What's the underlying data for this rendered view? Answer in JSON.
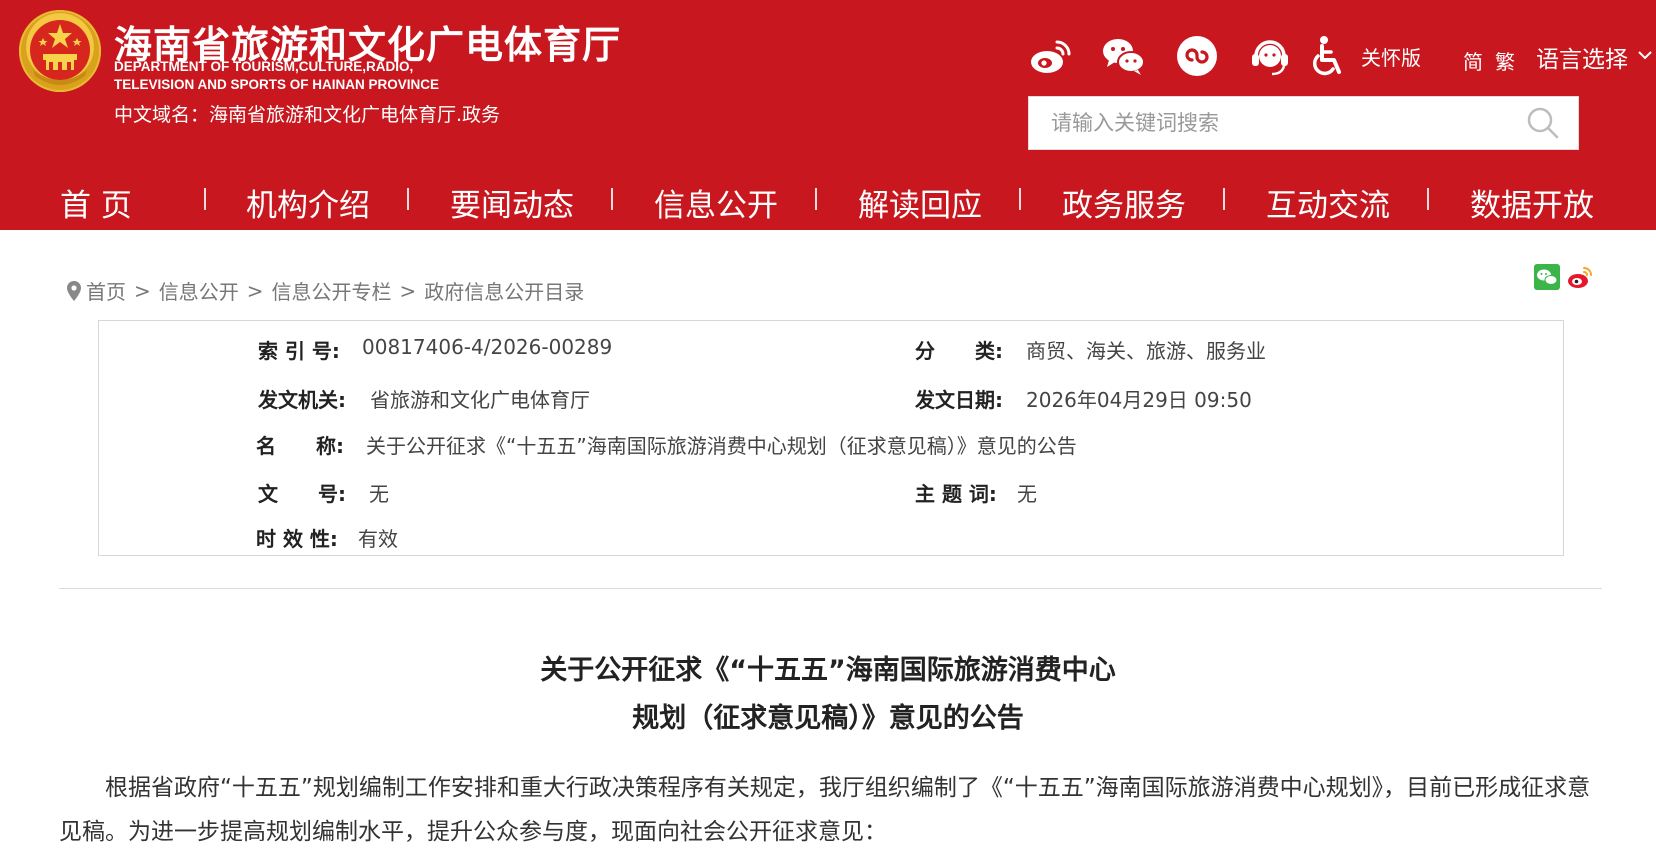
{
  "header": {
    "brand_cn": "海南省旅游和文化广电体育厅",
    "brand_en_line1": "DEPARTMENT OF TOURISM,CULTURE,RADIO,",
    "brand_en_line2": "TELEVISION AND SPORTS OF HAINAN PROVINCE",
    "domain_line": "中文域名：海南省旅游和文化广电体育厅.政务",
    "tools": {
      "icons": [
        "weibo-icon",
        "wechat-icon",
        "mini-program-icon",
        "customer-service-icon",
        "accessibility-icon"
      ],
      "care_label": "关怀版",
      "simplified": "简",
      "traditional": "繁",
      "language_select": "语言选择"
    },
    "search": {
      "placeholder": "请输入关键词搜索"
    },
    "colors": {
      "header_bg": "#c8171e"
    }
  },
  "nav": {
    "items": [
      "首  页",
      "机构介绍",
      "要闻动态",
      "信息公开",
      "解读回应",
      "政务服务",
      "互动交流",
      "数据开放"
    ]
  },
  "breadcrumb": {
    "items": [
      "首页",
      "信息公开",
      "信息公开专栏",
      "政府信息公开目录"
    ],
    "separator": ">"
  },
  "share": {
    "icons": [
      "wechat-share-icon",
      "weibo-share-icon"
    ]
  },
  "info": {
    "index_label": "索 引 号:",
    "index_value": "00817406-4/2026-00289",
    "category_label": "分　　类:",
    "category_value": "商贸、海关、旅游、服务业",
    "issuer_label": "发文机关:",
    "issuer_value": "省旅游和文化广电体育厅",
    "date_label": "发文日期:",
    "date_value": "2026年04月29日 09:50",
    "name_label": "名　　称:",
    "name_value": "关于公开征求《“十五五”海南国际旅游消费中心规划（征求意见稿）》意见的公告",
    "docno_label": "文　　号:",
    "docno_value": "无",
    "topic_label": "主 题 词:",
    "topic_value": "无",
    "validity_label": "时 效 性:",
    "validity_value": "有效"
  },
  "article": {
    "title_line1": "关于公开征求《“十五五”海南国际旅游消费中心",
    "title_line2": "规划（征求意见稿）》意见的公告",
    "paragraph1": "根据省政府“十五五”规划编制工作安排和重大行政决策程序有关规定，我厅组织编制了《“十五五”海南国际旅游消费中心规划》，目前已形成征求意见稿。为进一步提高规划编制水平，提升公众参与度，现面向社会公开征求意见："
  }
}
